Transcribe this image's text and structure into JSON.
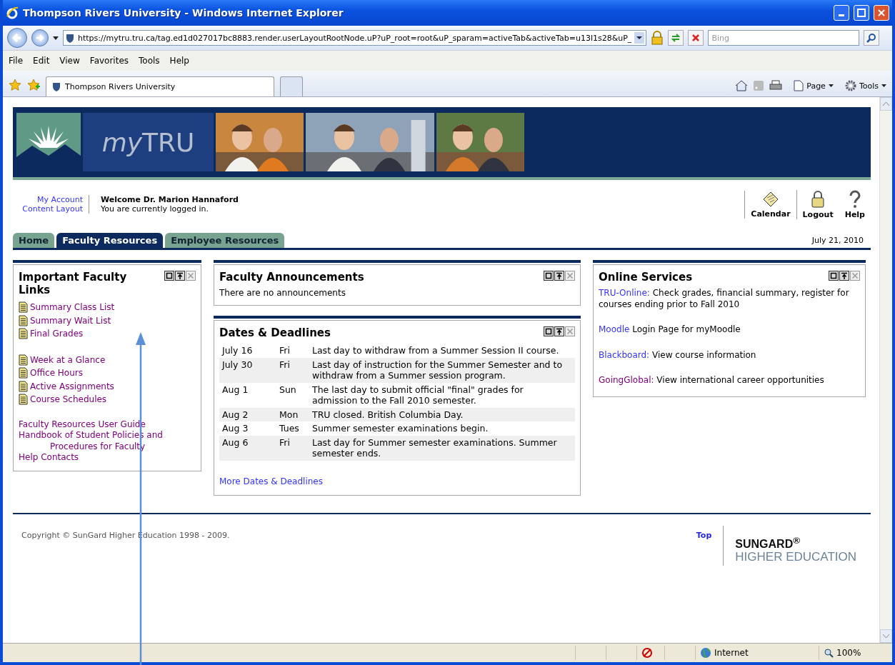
{
  "window": {
    "title": "Thompson Rivers University - Windows Internet Explorer"
  },
  "address_bar": {
    "url": "https://mytru.tru.ca/tag.ed1d027017bc8883.render.userLayoutRootNode.uP?uP_root=root&uP_sparam=activeTab&activeTab=u13l1s28&uP_"
  },
  "search": {
    "placeholder": "Bing"
  },
  "menu": [
    "File",
    "Edit",
    "View",
    "Favorites",
    "Tools",
    "Help"
  ],
  "browser_tabs": [
    {
      "label": "Thompson Rivers University",
      "selected": true
    }
  ],
  "command_bar": [
    {
      "label": "Page",
      "kind": "page"
    },
    {
      "label": "Tools",
      "kind": "tools"
    }
  ],
  "banner": {
    "logo_prefix": "my",
    "logo_suffix": "TRU"
  },
  "user_links": [
    "My Account",
    "Content Layout"
  ],
  "welcome": {
    "title": "Welcome Dr. Marion Hannaford",
    "subtitle": "You are currently logged in."
  },
  "tools": [
    {
      "label": "Calendar",
      "kind": "calendar"
    },
    {
      "label": "Logout",
      "kind": "logout"
    },
    {
      "label": "Help",
      "kind": "help"
    }
  ],
  "tabs": [
    {
      "label": "Home",
      "selected": false
    },
    {
      "label": "Faculty Resources",
      "selected": true
    },
    {
      "label": "Employee Resources",
      "selected": false
    }
  ],
  "date": "July 21, 2010",
  "faculty_links": {
    "title": "Important Faculty Links",
    "groups": [
      {
        "kind": "doc",
        "links": [
          {
            "label": "Summary Class List",
            "visited": true
          },
          {
            "label": "Summary Wait List",
            "visited": true
          },
          {
            "label": "Final Grades",
            "visited": true
          }
        ]
      },
      {
        "kind": "doc",
        "links": [
          {
            "label": "Week at a Glance",
            "visited": true
          },
          {
            "label": "Office Hours",
            "visited": true
          },
          {
            "label": "Active Assignments",
            "visited": true
          },
          {
            "label": "Course Schedules",
            "visited": true
          }
        ]
      },
      {
        "kind": "plain",
        "links": [
          {
            "label": "Faculty Resources User Guide",
            "visited": true
          },
          {
            "label": "Handbook of Student Policies and Procedures for Faculty",
            "visited": true
          },
          {
            "label": "Help Contacts",
            "visited": true
          }
        ]
      }
    ]
  },
  "announcements": {
    "title": "Faculty Announcements",
    "text": "There are no announcements"
  },
  "deadlines": {
    "title": "Dates & Deadlines",
    "rows": [
      {
        "date": "July 16",
        "day": "Fri",
        "text": "Last day to withdraw from a Summer Session II course."
      },
      {
        "date": "July 30",
        "day": "Fri",
        "text": "Last day of instruction for the Summer Semester and to withdraw from a Summer session program."
      },
      {
        "date": "Aug 1",
        "day": "Sun",
        "text": "The last day to submit official \"final\" grades for admission to the Fall 2010 semester."
      },
      {
        "date": "Aug 2",
        "day": "Mon",
        "text": "TRU closed. British Columbia Day."
      },
      {
        "date": "Aug 3",
        "day": "Tues",
        "text": "Summer semester examinations begin."
      },
      {
        "date": "Aug 6",
        "day": "Fri",
        "text": "Last day for Summer semester examinations. Summer semester ends."
      }
    ],
    "more_link": {
      "label": "More Dates & Deadlines",
      "visited": false
    }
  },
  "online_services": {
    "title": "Online Services",
    "items": [
      {
        "link": "TRU-Online:",
        "text": "Check grades, financial summary, register for courses ending prior to Fall 2010",
        "visited": false
      },
      {
        "link": "Moodle",
        "text": "Login Page for myMoodle",
        "visited": false
      },
      {
        "link": "Blackboard:",
        "text": "View course information",
        "visited": false
      },
      {
        "link": "GoingGlobal:",
        "text": "View international career opportunities",
        "visited": true
      }
    ]
  },
  "footer": {
    "copyright": "Copyright © SunGard Higher Education 1998 - 2009.",
    "top_link": "Top",
    "logo_line1": "SUNGARD$^{®}$",
    "logo_line2": "HIGHER EDUCATION"
  },
  "status_bar": {
    "zone": "Internet",
    "zoom": "100%"
  }
}
